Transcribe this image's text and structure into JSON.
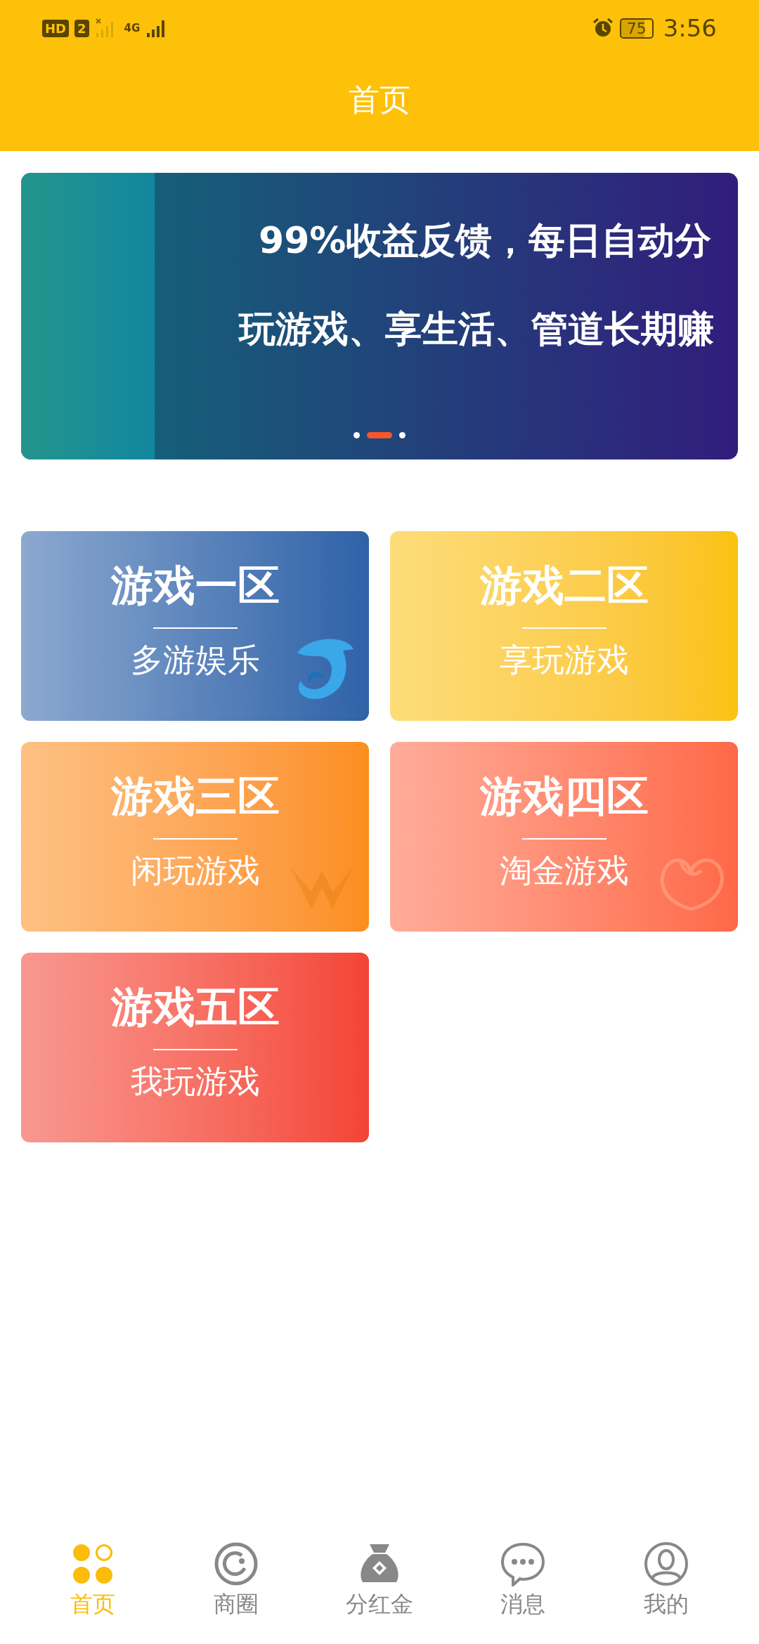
{
  "status_bar": {
    "badges": [
      "HD",
      "2"
    ],
    "network": "4G",
    "battery": "75",
    "time": "3:56"
  },
  "header": {
    "title": "首页"
  },
  "banner": {
    "lines": [
      "99%收益反馈，每日自动分",
      "玩游戏、享生活、管道长期赚"
    ],
    "dots": [
      {
        "selected": false
      },
      {
        "selected": true
      },
      {
        "selected": false
      }
    ]
  },
  "zones": [
    {
      "title": "游戏一区",
      "subtitle": "多游娱乐",
      "kind": "dolphin",
      "color": "#2e62a8"
    },
    {
      "title": "游戏二区",
      "subtitle": "享玩游戏",
      "kind": "plain",
      "color": "#fbc10c"
    },
    {
      "title": "游戏三区",
      "subtitle": "闲玩游戏",
      "kind": "wings",
      "color": "#fc8e1d"
    },
    {
      "title": "游戏四区",
      "subtitle": "淘金游戏",
      "kind": "bean",
      "color": "#ff6847"
    },
    {
      "title": "游戏五区",
      "subtitle": "我玩游戏",
      "kind": "plain",
      "color": "#f34336"
    }
  ],
  "tab_bar": [
    {
      "label": "首页",
      "kind": "home",
      "selected": true
    },
    {
      "label": "商圈",
      "kind": "circle",
      "selected": false
    },
    {
      "label": "分红金",
      "kind": "bag",
      "selected": false
    },
    {
      "label": "消息",
      "kind": "chat",
      "selected": false
    },
    {
      "label": "我的",
      "kind": "user",
      "selected": false
    }
  ]
}
